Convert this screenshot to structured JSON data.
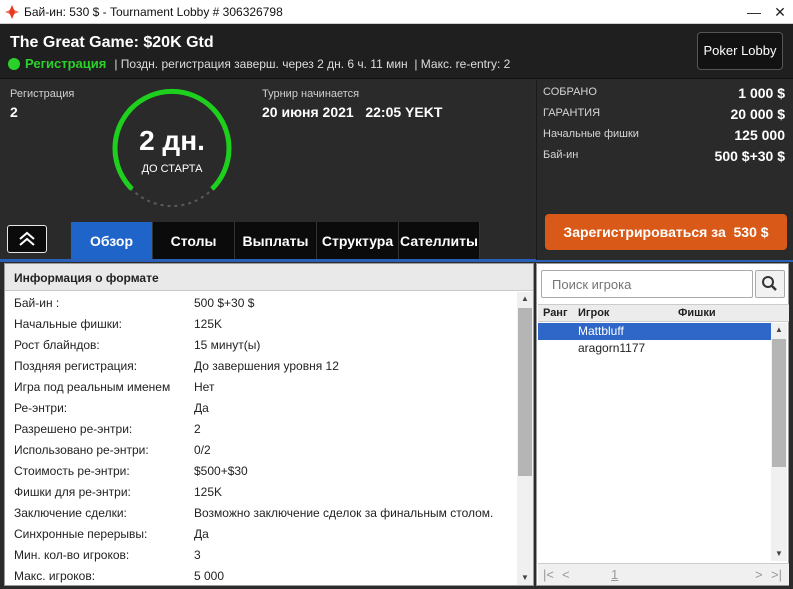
{
  "window": {
    "title": "Бай-ин: 530 $ - Tournament Lobby # 306326798",
    "minimize": "—",
    "close": "✕"
  },
  "header": {
    "tournament_name": "The Great Game: $20K Gtd",
    "status": "Регистрация",
    "late_reg": "| Поздн. регистрация заверш. через 2 дн. 6 ч. 11 мин",
    "max_reentry": "| Макс. re-entry: 2",
    "poker_lobby_label": "Poker Lobby"
  },
  "info": {
    "registration_label": "Регистрация",
    "registration_value": "2",
    "timer_value": "2 дн.",
    "timer_caption": "ДО СТАРТА",
    "starts_label": "Турнир начинается",
    "starts_value": "20 июня 2021   22:05 YEKT"
  },
  "tabs": [
    "Обзор",
    "Столы",
    "Выплаты",
    "Структура",
    "Сателлиты"
  ],
  "prize": {
    "rows": [
      {
        "label": "СОБРАНО",
        "value": "1 000 $"
      },
      {
        "label": "ГАРАНТИЯ",
        "value": "20 000 $"
      },
      {
        "label": "Начальные фишки",
        "value": "125 000"
      },
      {
        "label": "Бай-ин",
        "value": "500 $+30 $"
      }
    ],
    "register_label": "Зарегистрироваться за  530 $"
  },
  "format": {
    "header": "Информация о формате",
    "rows": [
      {
        "k": "Бай-ин :",
        "v": "500 $+30 $"
      },
      {
        "k": "Начальные фишки:",
        "v": "125K"
      },
      {
        "k": "Рост блайндов:",
        "v": "15 минут(ы)"
      },
      {
        "k": "Поздняя регистрация:",
        "v": "До завершения уровня 12"
      },
      {
        "k": "Игра под реальным именем",
        "v": "Нет"
      },
      {
        "k": "Ре-энтри:",
        "v": "Да"
      },
      {
        "k": "Разрешено ре-энтри:",
        "v": "2"
      },
      {
        "k": "Использовано ре-энтри:",
        "v": "0/2"
      },
      {
        "k": "Стоимость ре-энтри:",
        "v": "$500+$30"
      },
      {
        "k": "Фишки для ре-энтри:",
        "v": "125K"
      },
      {
        "k": "Заключение сделки:",
        "v": "Возможно заключение сделок за финальным столом."
      },
      {
        "k": "Синхронные перерывы:",
        "v": "Да"
      },
      {
        "k": "Мин. кол-во игроков:",
        "v": "3"
      },
      {
        "k": "Макс. игроков:",
        "v": "5 000"
      }
    ]
  },
  "players": {
    "search_placeholder": "Поиск игрока",
    "columns": [
      "Ранг",
      "Игрок",
      "Фишки"
    ],
    "rows": [
      {
        "name": "Mattbluff"
      },
      {
        "name": "aragorn1177"
      }
    ],
    "page": "1"
  }
}
